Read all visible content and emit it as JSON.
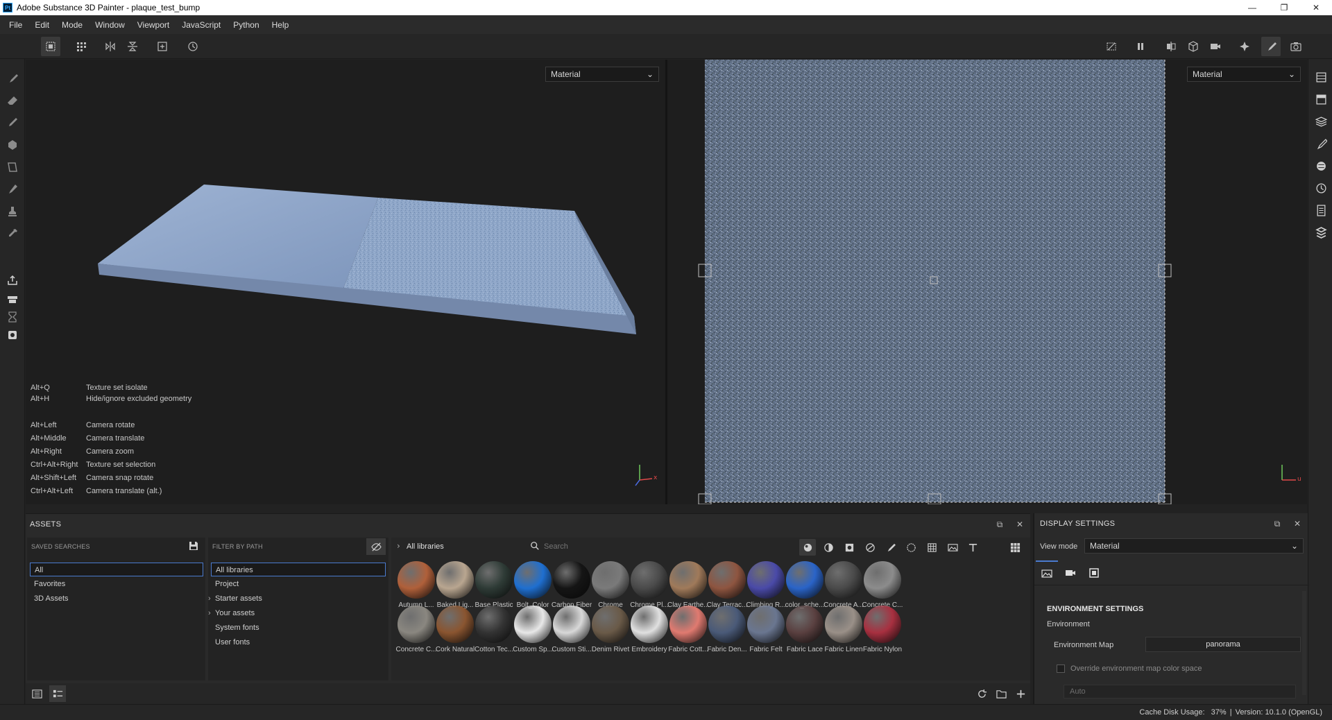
{
  "window": {
    "title": "Adobe Substance 3D Painter - plaque_test_bump",
    "logo_text": "Pt",
    "minimize": "—",
    "maximize": "❐",
    "close": "✕"
  },
  "menu": [
    "File",
    "Edit",
    "Mode",
    "Window",
    "Viewport",
    "JavaScript",
    "Python",
    "Help"
  ],
  "viewport3d": {
    "view_mode": "Material",
    "axis_x": "x",
    "shortcuts": [
      {
        "key": "Alt+Q",
        "desc": "Texture set isolate"
      },
      {
        "key": "Alt+H",
        "desc": "Hide/ignore excluded geometry"
      },
      {
        "key": "Alt+Left",
        "desc": "Camera rotate"
      },
      {
        "key": "Alt+Middle",
        "desc": "Camera translate"
      },
      {
        "key": "Alt+Right",
        "desc": "Camera zoom"
      },
      {
        "key": "Ctrl+Alt+Right",
        "desc": "Texture set selection"
      },
      {
        "key": "Alt+Shift+Left",
        "desc": "Camera snap rotate"
      },
      {
        "key": "Ctrl+Alt+Left",
        "desc": "Camera translate (alt.)"
      }
    ]
  },
  "viewport2d": {
    "view_mode": "Material",
    "axis_u": "u"
  },
  "assets": {
    "title": "ASSETS",
    "saved_searches_label": "SAVED SEARCHES",
    "saved_searches": [
      "All",
      "Favorites",
      "3D Assets"
    ],
    "filter_by_path_label": "FILTER BY PATH",
    "paths": [
      {
        "label": "All libraries",
        "arrow": ""
      },
      {
        "label": "Project",
        "arrow": ""
      },
      {
        "label": "Starter assets",
        "arrow": "›"
      },
      {
        "label": "Your assets",
        "arrow": "›"
      },
      {
        "label": "System fonts",
        "arrow": ""
      },
      {
        "label": "User fonts",
        "arrow": ""
      }
    ],
    "breadcrumb": "All libraries",
    "breadcrumb_arrow": "›",
    "search_placeholder": "Search",
    "items_row1": [
      {
        "label": "Autumn L...",
        "color": "#b0603a"
      },
      {
        "label": "Baked Lig...",
        "color": "#b9a690"
      },
      {
        "label": "Base Plastic",
        "color": "#2e3b36"
      },
      {
        "label": "Bolt_Color",
        "color": "#1f6fd0"
      },
      {
        "label": "Carbon Fiber",
        "color": "#151515"
      },
      {
        "label": "Chrome",
        "color": "#7a7a7a"
      },
      {
        "label": "Chrome Pl...",
        "color": "#4a4a4a"
      },
      {
        "label": "Clay Earthe...",
        "color": "#a07a5a"
      },
      {
        "label": "Clay Terrac...",
        "color": "#8e5540"
      },
      {
        "label": "Climbing R...",
        "color": "#4a4aa8"
      },
      {
        "label": "color_sche...",
        "color": "#2a64c8"
      },
      {
        "label": "Concrete A...",
        "color": "#4a4a4a"
      },
      {
        "label": "Concrete C...",
        "color": "#8c8c8c"
      }
    ],
    "items_row2": [
      {
        "label": "Concrete C...",
        "color": "#8a8780"
      },
      {
        "label": "Cork Natural",
        "color": "#8a5530"
      },
      {
        "label": "Cotton Tec...",
        "color": "#333333"
      },
      {
        "label": "Custom Sp...",
        "color": "#e8e8e8"
      },
      {
        "label": "Custom Sti...",
        "color": "#d8d8d8"
      },
      {
        "label": "Denim Rivet",
        "color": "#6a5a48"
      },
      {
        "label": "Embroidery",
        "color": "#e0e0e0"
      },
      {
        "label": "Fabric Cott...",
        "color": "#e07a70"
      },
      {
        "label": "Fabric Den...",
        "color": "#4a5a78"
      },
      {
        "label": "Fabric Felt",
        "color": "#6a7690"
      },
      {
        "label": "Fabric Lace",
        "color": "#5a4040"
      },
      {
        "label": "Fabric Linen",
        "color": "#9a9088"
      },
      {
        "label": "Fabric Nylon",
        "color": "#a83040"
      }
    ]
  },
  "display_settings": {
    "title": "DISPLAY SETTINGS",
    "view_mode_label": "View mode",
    "view_mode_value": "Material",
    "section_title": "ENVIRONMENT SETTINGS",
    "environment_label": "Environment",
    "environment_map_label": "Environment Map",
    "environment_map_value": "panorama",
    "override_label": "Override environment map color space",
    "override_checked": false,
    "colorspace_value": "Auto"
  },
  "status": {
    "cache_label": "Cache Disk Usage:",
    "cache_value": "37%",
    "separator": "|",
    "version": "Version: 10.1.0 (OpenGL)"
  },
  "colors": {
    "accent": "#4a7bd0",
    "plaque": "#8aa3c8"
  }
}
